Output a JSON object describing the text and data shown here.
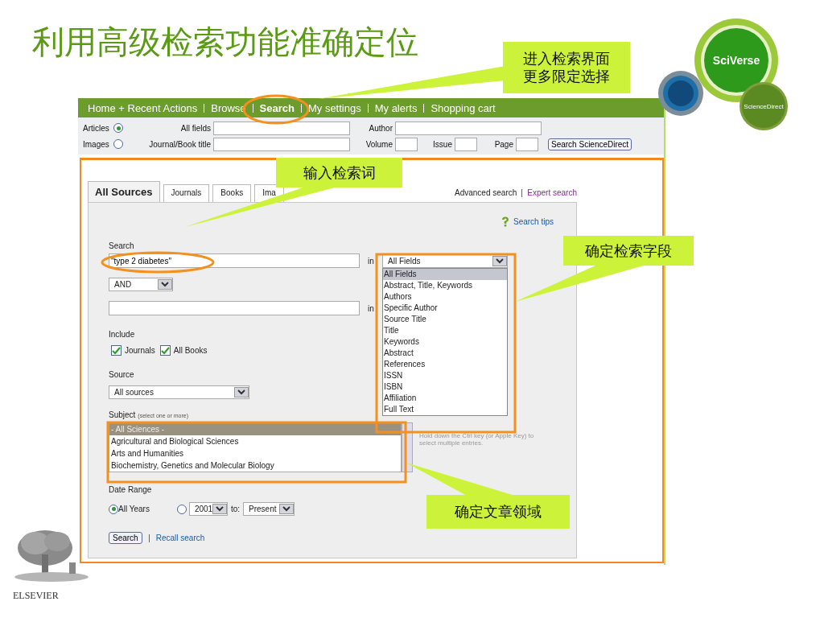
{
  "slide": {
    "title": "利用高级检索功能准确定位"
  },
  "nav": [
    {
      "label": "Home + Recent Actions",
      "selected": false
    },
    {
      "label": "Browse",
      "selected": false
    },
    {
      "label": "Search",
      "selected": true
    },
    {
      "label": "My settings",
      "selected": false
    },
    {
      "label": "My alerts",
      "selected": false
    },
    {
      "label": "Shopping cart",
      "selected": false
    }
  ],
  "quick_search": {
    "types": [
      {
        "label": "Articles",
        "selected": true
      },
      {
        "label": "Images",
        "selected": false
      }
    ],
    "fields": [
      {
        "label": "All fields"
      },
      {
        "label": "Author"
      },
      {
        "label": "Journal/Book title"
      },
      {
        "label": "Volume"
      },
      {
        "label": "Issue"
      },
      {
        "label": "Page"
      }
    ],
    "button": "Search ScienceDirect"
  },
  "tabs": [
    {
      "label": "All Sources",
      "selected": true
    },
    {
      "label": "Journals",
      "selected": false
    },
    {
      "label": "Books",
      "selected": false
    },
    {
      "label": "Ima",
      "selected": false
    }
  ],
  "links": {
    "advanced": "Advanced search",
    "expert": "Expert search",
    "tips": "Search tips"
  },
  "form": {
    "search_label": "Search",
    "term_1": "\"type 2 diabetes\"",
    "in_label_1": "in",
    "field_1": "All Fields",
    "field_options": [
      {
        "label": "All Fields",
        "selected": true
      },
      {
        "label": "Abstract, Title, Keywords",
        "selected": false
      },
      {
        "label": "Authors",
        "selected": false
      },
      {
        "label": "Specific Author",
        "selected": false
      },
      {
        "label": "Source Title",
        "selected": false
      },
      {
        "label": "Title",
        "selected": false
      },
      {
        "label": "Keywords",
        "selected": false
      },
      {
        "label": "Abstract",
        "selected": false
      },
      {
        "label": "References",
        "selected": false
      },
      {
        "label": "ISSN",
        "selected": false
      },
      {
        "label": "ISBN",
        "selected": false
      },
      {
        "label": "Affiliation",
        "selected": false
      },
      {
        "label": "Full Text",
        "selected": false
      }
    ],
    "operator": "AND",
    "in_label_2": "in",
    "include_label": "Include",
    "include": [
      {
        "label": "Journals",
        "checked": true
      },
      {
        "label": "All Books",
        "checked": true
      }
    ],
    "source_label": "Source",
    "source": "All sources",
    "subject_label": "Subject",
    "subject_hint": "(select one or more)",
    "subjects": [
      {
        "label": "- All Sciences -",
        "selected": true
      },
      {
        "label": "Agricultural and Biological Sciences",
        "selected": false
      },
      {
        "label": "Arts and Humanities",
        "selected": false
      },
      {
        "label": "Biochemistry, Genetics and Molecular Biology",
        "selected": false
      }
    ],
    "subject_note": "Hold down the Ctrl key (or Apple Key) to select multiple entries.",
    "date_label": "Date Range",
    "date_options": [
      {
        "label": "All Years",
        "selected": true
      },
      {
        "selected": false
      }
    ],
    "date_from": "2001",
    "to_label": "to:",
    "date_to": "Present",
    "search_button": "Search",
    "recall": "Recall search"
  },
  "callouts": [
    {
      "lines": [
        "进入检索界面",
        "更多限定选择"
      ]
    },
    {
      "lines": [
        "输入检索词"
      ]
    },
    {
      "lines": [
        "确定检索字段"
      ]
    },
    {
      "lines": [
        "确定文章领域"
      ]
    }
  ],
  "logos": {
    "sciverse": "SciVerse",
    "sciencedirect": "ScienceDirect",
    "elsevier": "ELSEVIER"
  }
}
